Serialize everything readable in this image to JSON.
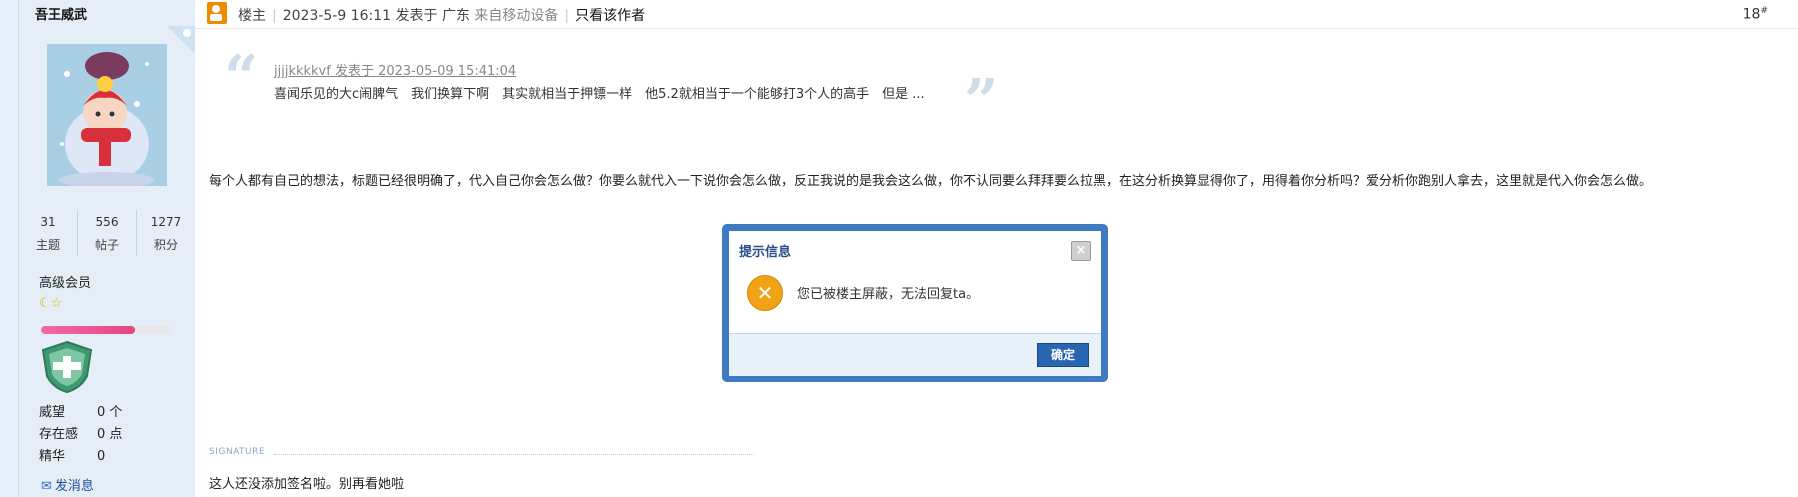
{
  "user": {
    "name": "吾王威武",
    "stats": [
      {
        "value": "31",
        "label": "主题"
      },
      {
        "value": "556",
        "label": "帖子"
      },
      {
        "value": "1277",
        "label": "积分"
      }
    ],
    "group": "高级会员",
    "level_progress": 0.72,
    "fields": [
      {
        "key": "威望",
        "value": "0 个"
      },
      {
        "key": "存在感",
        "value": "0 点"
      },
      {
        "key": "精华",
        "value": "0"
      }
    ],
    "send_message": "发消息"
  },
  "post": {
    "owner_label": "楼主",
    "timestamp": "2023-5-9 16:11 发表于 广东",
    "device": "来自移动设备",
    "author_only": "只看该作者",
    "floor": "18",
    "floor_sup": "#",
    "quote_meta": "jjjjkkkkvf 发表于 2023-05-09 15:41:04",
    "quote_body": "喜闻乐见的大c闹脾气　我们换算下啊　其实就相当于押镖一样　他5.2就相当于一个能够打3个人的高手　但是 ...",
    "body": "每个人都有自己的想法，标题已经很明确了，代入自己你会怎么做？你要么就代入一下说你会怎么做，反正我说的是我会这么做，你不认同要么拜拜要么拉黑，在这分析换算显得你了，用得着你分析吗？爱分析你跑别人拿去，这里就是代入你会怎么做。",
    "signature_label": "SIGNATURE",
    "signature": "这人还没添加签名啦。别再看她啦"
  },
  "dialog": {
    "title": "提示信息",
    "message": "您已被楼主屏蔽，无法回复ta。",
    "ok": "确定",
    "close": "×"
  }
}
